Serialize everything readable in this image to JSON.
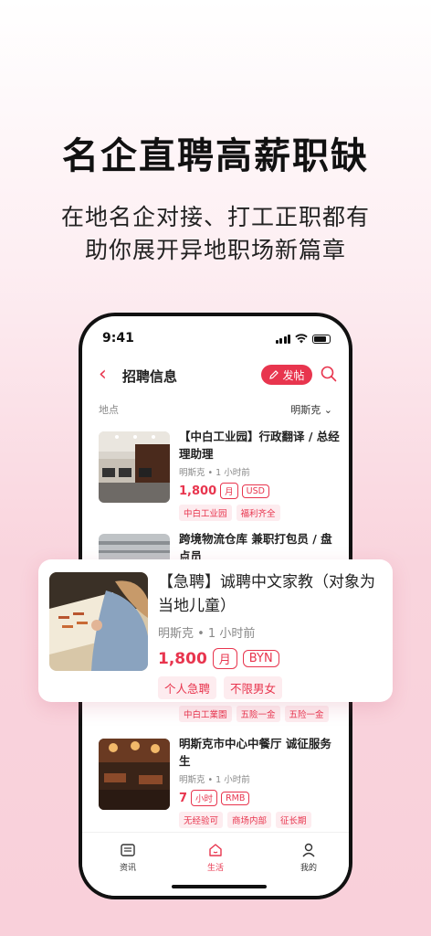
{
  "headline": "名企直聘高薪职缺",
  "subline1": "在地名企对接、打工正职都有",
  "subline2": "助你展开异地职场新篇章",
  "status": {
    "time": "9:41"
  },
  "nav": {
    "title": "招聘信息",
    "post_label": "发帖"
  },
  "location": {
    "label": "地点",
    "value": "明斯克"
  },
  "jobs": [
    {
      "title": "【中白工业园】行政翻译 / 总经理助理",
      "meta": "明斯克 • 1 小时前",
      "price": "1,800",
      "units": [
        "月",
        "USD"
      ],
      "tags": [
        "中白工业园",
        "福利齐全"
      ]
    },
    {
      "title": "跨境物流仓库 兼职打包员 / 盘点员"
    },
    {
      "tags": [
        "中白工業園",
        "五險一金",
        "五险一金"
      ]
    },
    {
      "title": "明斯克市中心中餐厅 诚征服务生",
      "meta": "明斯克 • 1 小时前",
      "price": "7",
      "units": [
        "小时",
        "RMB"
      ],
      "tags": [
        "无经验可",
        "商场内部",
        "征长期"
      ]
    }
  ],
  "featured": {
    "title": "【急聘】诚聘中文家教（对象为当地儿童）",
    "meta": "明斯克 • 1 小时前",
    "price": "1,800",
    "units": [
      "月",
      "BYN"
    ],
    "tags": [
      "个人急聘",
      "不限男女"
    ]
  },
  "tabs": [
    {
      "label": "资讯",
      "icon": "news-icon"
    },
    {
      "label": "生活",
      "icon": "home-icon"
    },
    {
      "label": "我的",
      "icon": "profile-icon"
    }
  ],
  "colors": {
    "accent": "#e8354e",
    "tag_bg": "#fdecef"
  }
}
